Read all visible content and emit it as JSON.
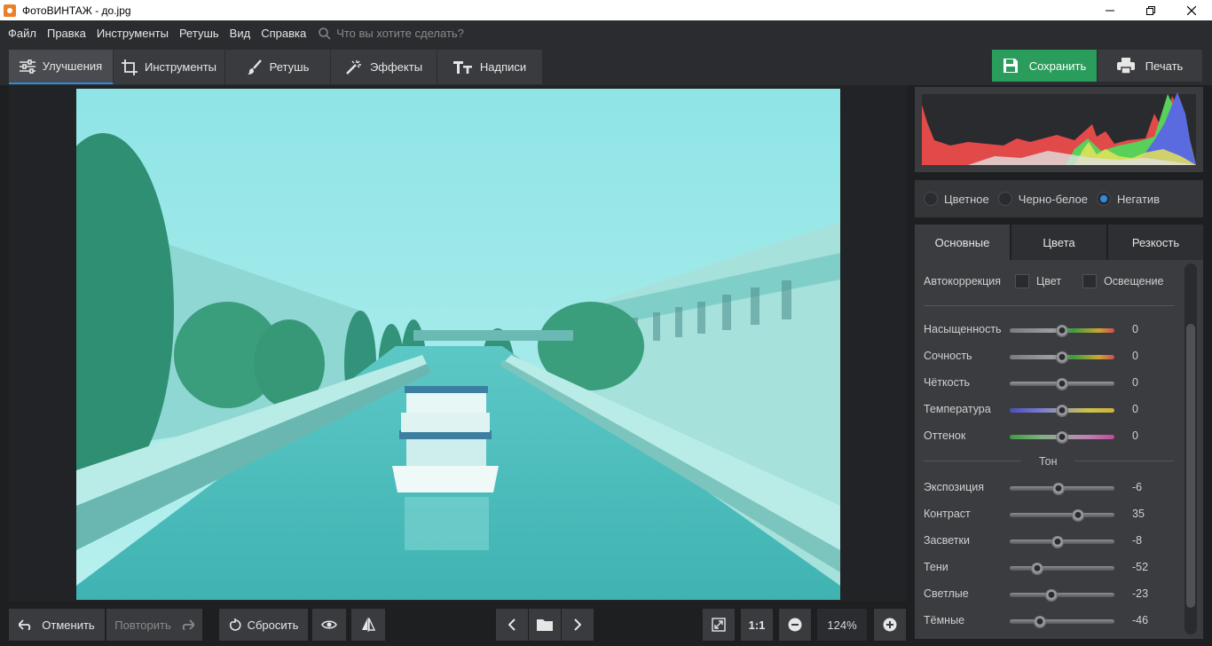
{
  "window": {
    "title": "ФотоВИНТАЖ - до.jpg"
  },
  "menu": {
    "items": [
      "Файл",
      "Правка",
      "Инструменты",
      "Ретушь",
      "Вид",
      "Справка"
    ],
    "search_placeholder": "Что вы хотите сделать?"
  },
  "tabs": [
    {
      "label": "Улучшения",
      "icon": "sliders-icon"
    },
    {
      "label": "Инструменты",
      "icon": "crop-icon"
    },
    {
      "label": "Ретушь",
      "icon": "brush-icon"
    },
    {
      "label": "Эффекты",
      "icon": "magic-wand-icon"
    },
    {
      "label": "Надписи",
      "icon": "text-icon"
    }
  ],
  "actions": {
    "save": "Сохранить",
    "print": "Печать"
  },
  "modes": {
    "items": [
      "Цветное",
      "Черно-белое",
      "Негатив"
    ],
    "selected": "Негатив"
  },
  "panel_tabs": {
    "items": [
      "Основные",
      "Цвета",
      "Резкость"
    ],
    "active": "Основные"
  },
  "autocorrection": {
    "label": "Автокоррекция",
    "options": [
      "Цвет",
      "Освещение"
    ]
  },
  "sliders_basic": [
    {
      "label": "Насыщенность",
      "value": "0",
      "fraction": 0.5,
      "gradient": "linear-gradient(90deg,#7a7b80,#9c9da2 40%,#3f9a3f 60%,#c7a632 85%,#d24d4d)"
    },
    {
      "label": "Сочность",
      "value": "0",
      "fraction": 0.5,
      "gradient": "linear-gradient(90deg,#7a7b80,#9c9da2 40%,#3f9a3f 60%,#c7a632 85%,#d24d4d)"
    },
    {
      "label": "Чёткость",
      "value": "0",
      "fraction": 0.5,
      "gradient": "linear-gradient(#9a9ba0,#5c5d61)"
    },
    {
      "label": "Температура",
      "value": "0",
      "fraction": 0.5,
      "gradient": "linear-gradient(90deg,#4a4fb8,#7a7bd0 30%,#a0a0a0 50%,#c9c34a 75%,#d0b23a)"
    },
    {
      "label": "Оттенок",
      "value": "0",
      "fraction": 0.5,
      "gradient": "linear-gradient(90deg,#3f9a3f,#7fb07f 30%,#a0a0a0 50%,#c07fb0 75%,#c04a9a)"
    }
  ],
  "tone_section": "Тон",
  "sliders_tone": [
    {
      "label": "Экспозиция",
      "value": "-6",
      "fraction": 0.47
    },
    {
      "label": "Контраст",
      "value": "35",
      "fraction": 0.65
    },
    {
      "label": "Засветки",
      "value": "-8",
      "fraction": 0.46
    },
    {
      "label": "Тени",
      "value": "-52",
      "fraction": 0.26
    },
    {
      "label": "Светлые",
      "value": "-23",
      "fraction": 0.4
    },
    {
      "label": "Тёмные",
      "value": "-46",
      "fraction": 0.29
    }
  ],
  "bottom": {
    "undo": "Отменить",
    "redo": "Повторить",
    "reset": "Сбросить",
    "ratio": "1:1",
    "zoom": "124%"
  },
  "colors": {
    "accent": "#2d8ce0",
    "save_bg": "#2a9c5b",
    "panel_bg": "#3b3c40",
    "app_bg": "#1e1f21"
  }
}
